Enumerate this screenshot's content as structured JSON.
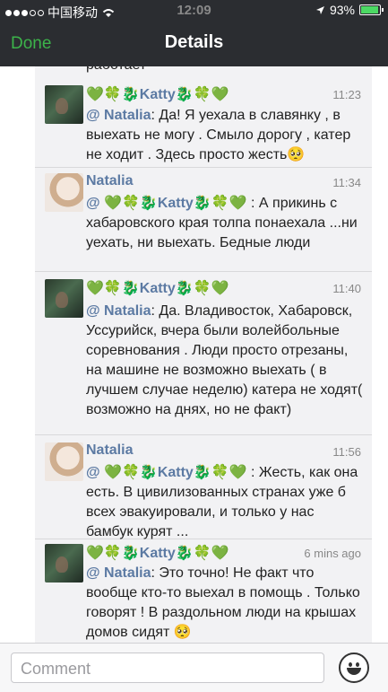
{
  "status_bar": {
    "carrier": "中国移动",
    "time": "12:09",
    "battery": "93%",
    "battery_level": 0.93
  },
  "nav": {
    "done_label": "Done",
    "title": "Details"
  },
  "cut_text": "работает",
  "messages": [
    {
      "author": "💚🍀🐉Katty🐉🍀💚",
      "time": "11:23",
      "mention": "@ Natalia",
      "body": ": Да! Я уехала в славянку , в выехать не могу . Смыло дорогу , катер не ходит . Здесь просто жесть🥺"
    },
    {
      "author": "Natalia",
      "time": "11:34",
      "mention": "@ 💚🍀🐉Katty🐉🍀💚",
      "body": " : А прикинь с хабаровского края толпа понаехала ...ни уехать, ни выехать. Бедные люди"
    },
    {
      "author": "💚🍀🐉Katty🐉🍀💚",
      "time": "11:40",
      "mention": "@ Natalia",
      "body": ": Да. Владивосток, Хабаровск, Уссурийск, вчера были волейбольные соревнования . Люди просто отрезаны, на машине не возможно выехать ( в лучшем случае неделю) катера не ходят( возможно на днях, но не факт)"
    },
    {
      "author": "Natalia",
      "time": "11:56",
      "mention": "@ 💚🍀🐉Katty🐉🍀💚",
      "body": " : Жесть, как она есть. В цивилизованных странах уже б всех эвакуировали, и только у нас бамбук курят ..."
    },
    {
      "author": "💚🍀🐉Katty🐉🍀💚",
      "time": "6 mins ago",
      "mention": "@ Natalia",
      "body": ": Это точно! Не факт что вообще кто-то выехал в помощь . Только говорят ! В раздольном люди на крышах домов сидят 🥺"
    }
  ],
  "comment": {
    "placeholder": "Comment"
  }
}
